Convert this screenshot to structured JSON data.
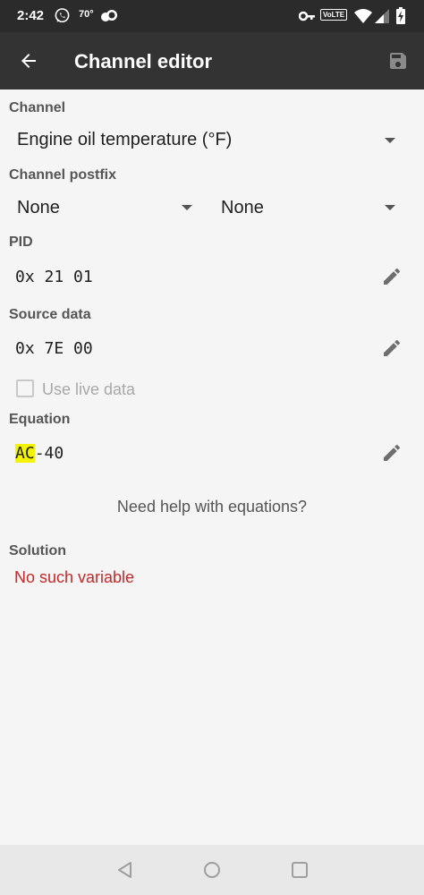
{
  "status_bar": {
    "time": "2:42",
    "temperature": "70°",
    "network_badge": "VoLTE",
    "icons": [
      "whatsapp-icon",
      "cloud-icon",
      "key-icon",
      "wifi-icon",
      "signal-icon",
      "battery-charging-icon"
    ]
  },
  "app_bar": {
    "title": "Channel editor",
    "back_icon": "arrow-back-icon",
    "save_icon": "save-icon"
  },
  "form": {
    "channel": {
      "label": "Channel",
      "value": "Engine oil temperature (°F)"
    },
    "channel_postfix": {
      "label": "Channel postfix",
      "value_1": "None",
      "value_2": "None"
    },
    "pid": {
      "label": "PID",
      "value": "0x 21 01"
    },
    "source_data": {
      "label": "Source data",
      "value": "0x 7E 00"
    },
    "use_live_data": {
      "label": "Use live data",
      "checked": false,
      "enabled": false
    },
    "equation": {
      "label": "Equation",
      "variable": "AC",
      "rest": "-40",
      "highlight_color": "#f4f400"
    },
    "help_link": "Need help with equations?",
    "solution": {
      "label": "Solution",
      "value": "No such variable",
      "color": "#c62828"
    }
  },
  "nav_bar": {
    "buttons": [
      "back-triangle-icon",
      "home-circle-icon",
      "recents-square-icon"
    ]
  }
}
